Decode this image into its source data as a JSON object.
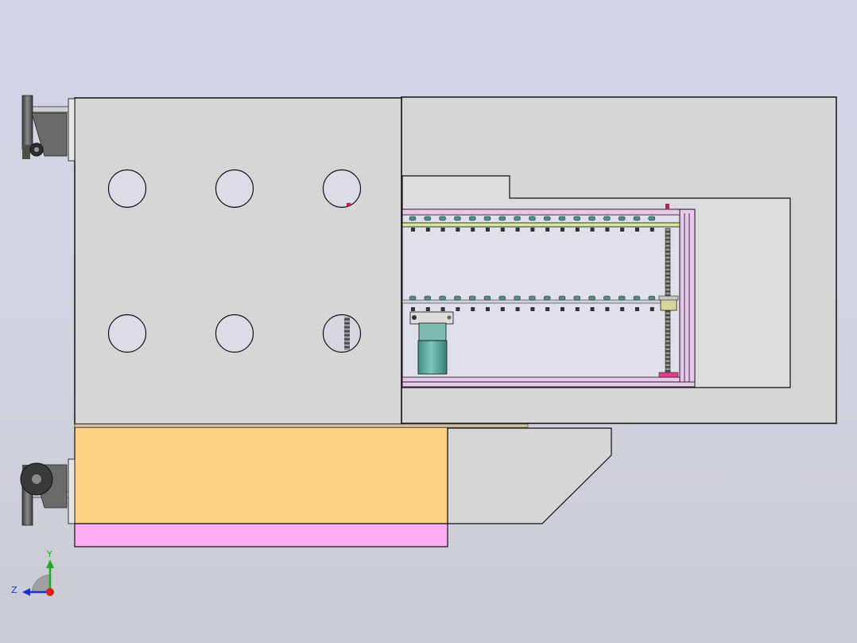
{
  "view": {
    "background_top": "#d2d3e6",
    "background_bottom": "#c9cbd3",
    "part_gray": "#d6d6d6",
    "outline": "#111111",
    "base_orange": "#ffd284",
    "base_pink": "#ffacf6",
    "rail_pink": "#e8c8ec",
    "rail_green": "#d6e8a0",
    "motor_teal": "#5aa89c",
    "screw_dark": "#4a4a4a",
    "caster_dark": "#555555"
  },
  "triad": {
    "y_label": "Y",
    "z_label": "Z",
    "y_color": "#1fa824",
    "z_color": "#1c2fd0",
    "x_color": "#e01b1b"
  },
  "parts": {
    "top_casters": [
      "caster",
      "caster"
    ],
    "panel_holes": 6,
    "chain_rows": 2,
    "lead_screw": "lead-screw",
    "motor": "stepper-motor"
  }
}
